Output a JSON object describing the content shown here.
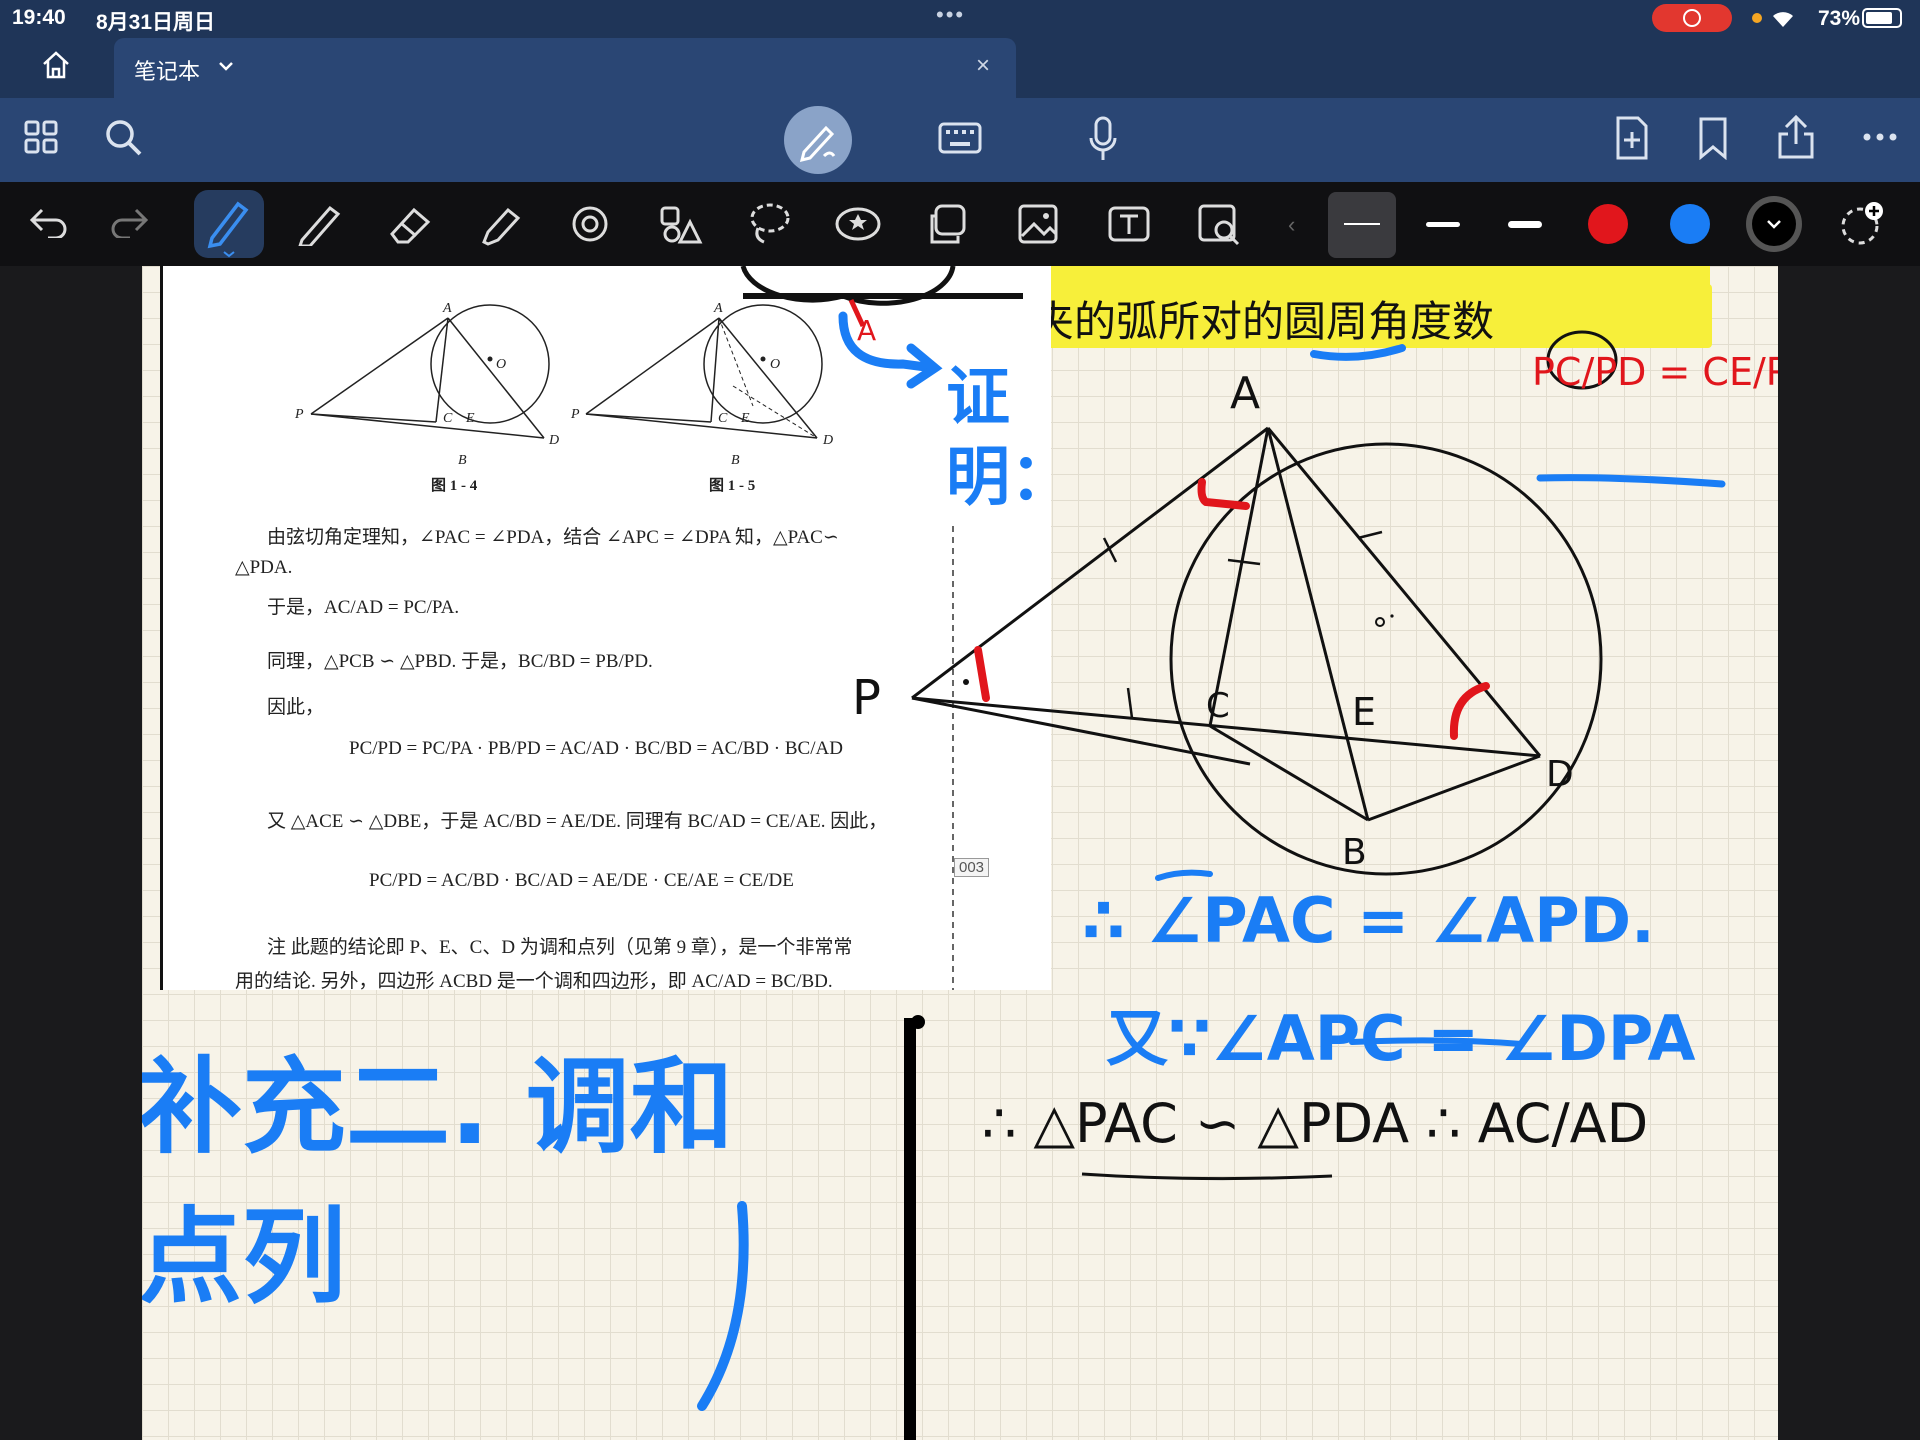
{
  "status_bar": {
    "time": "19:40",
    "date": "8月31日周日",
    "battery": "73%"
  },
  "tab": {
    "title": "笔记本",
    "close": "×"
  },
  "toolbar_top": {
    "left": [
      "grid-icon",
      "search-icon"
    ],
    "center": [
      "pen-mode-icon",
      "keyboard-icon",
      "microphone-icon"
    ],
    "right": [
      "add-page-icon",
      "bookmark-icon",
      "share-icon",
      "more-icon"
    ]
  },
  "toolbar_tools": {
    "tools": [
      "undo-icon",
      "redo-icon",
      "pen-icon",
      "pencil-icon",
      "eraser-icon",
      "highlighter-icon",
      "shape-icon",
      "element-icon",
      "lasso-icon",
      "sticker-icon",
      "copy-icon",
      "image-icon",
      "text-icon",
      "image-search-icon"
    ],
    "colors": {
      "red": "#e1161c",
      "blue": "#1a7df5",
      "black": "#000000"
    }
  },
  "document": {
    "fig1_caption": "图 1 - 4",
    "fig2_caption": "图 1 - 5",
    "line1": "由弦切角定理知，∠PAC = ∠PDA，结合 ∠APC = ∠DPA 知，△PAC∽",
    "line2": "△PDA.",
    "line3": "于是，AC/AD = PC/PA.",
    "line4": "同理，△PCB ∽ △PBD. 于是，BC/BD = PB/PD.",
    "line5": "因此，",
    "line6": "PC/PD = PC/PA · PB/PD = AC/AD · BC/BD = AC/BD · BC/AD",
    "line7": "又 △ACE ∽ △DBE，于是 AC/BD = AE/DE. 同理有 BC/AD = CE/AE. 因此，",
    "line8": "PC/PD = AC/BD · BC/AD = AE/DE · CE/AE = CE/DE",
    "note": "注   此题的结论即 P、E、C、D 为调和点列（见第 9 章），是一个非常常",
    "note2": "用的结论. 另外，四边形 ACBD 是一个调和四边形，即 AC/AD = BC/BD.",
    "page_label": "003"
  },
  "handwriting": {
    "top_note": "夹的弧所对的圆周角度数",
    "proof_label": "证明：",
    "step1": "∴ ∠PAC = ∠APD.",
    "step2": "又∵∠APC = ∠DPA",
    "step3": "∴ △PAC ∽ △PDA  ∴ AC/AD",
    "ratio": "PC/PD = CE/PE",
    "title": "补充二. 调和点列",
    "points": {
      "A": "A",
      "P": "P",
      "C": "C",
      "E": "E",
      "B": "B",
      "D": "D",
      "O": "O"
    }
  }
}
